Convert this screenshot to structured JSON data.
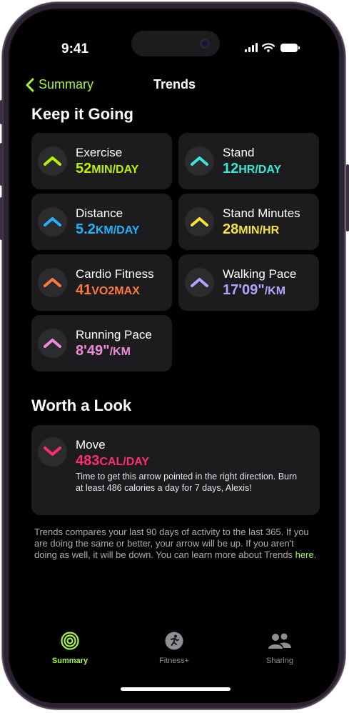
{
  "status_bar": {
    "time": "9:41"
  },
  "nav": {
    "back_label": "Summary",
    "title": "Trends"
  },
  "sections": {
    "keep_going": "Keep it Going",
    "worth_look": "Worth a Look"
  },
  "colors": {
    "accent_green": "#a3f740",
    "exercise": "#b9f200",
    "stand": "#3ce6d6",
    "distance": "#21b3ff",
    "stand_minutes": "#f5e23a",
    "cardio": "#ff7a3d",
    "walking": "#b6a1ff",
    "running": "#ef8ad9",
    "move": "#ff2d6f"
  },
  "trends": [
    {
      "label": "Exercise",
      "value": "52",
      "unit": "MIN/DAY",
      "direction": "up",
      "color_key": "exercise"
    },
    {
      "label": "Stand",
      "value": "12",
      "unit": "HR/DAY",
      "direction": "up",
      "color_key": "stand"
    },
    {
      "label": "Distance",
      "value": "5.2",
      "unit": "KM/DAY",
      "direction": "up",
      "color_key": "distance"
    },
    {
      "label": "Stand Minutes",
      "value": "28",
      "unit": "MIN/HR",
      "direction": "up",
      "color_key": "stand_minutes"
    },
    {
      "label": "Cardio Fitness",
      "value": "41",
      "unit": "VO2MAX",
      "direction": "up",
      "color_key": "cardio"
    },
    {
      "label": "Walking Pace",
      "value": "17'09\"",
      "unit": "/KM",
      "direction": "up",
      "color_key": "walking"
    },
    {
      "label": "Running Pace",
      "value": "8'49\"",
      "unit": "/KM",
      "direction": "up",
      "color_key": "running"
    }
  ],
  "worth_look": {
    "label": "Move",
    "value": "483",
    "unit": "CAL/DAY",
    "direction": "down",
    "description": "Time to get this arrow pointed in the right direction. Burn at least 486 calories a day for 7 days, Alexis!"
  },
  "footnote": {
    "text": "Trends compares your last 90 days of activity to the last 365. If you are doing the same or better, your arrow will be up. If you aren't doing as well, it will be down. You can learn more about Trends ",
    "link": "here",
    "end": "."
  },
  "tabs": [
    {
      "label": "Summary",
      "icon": "activity-rings-icon",
      "selected": true
    },
    {
      "label": "Fitness+",
      "icon": "runner-icon",
      "selected": false
    },
    {
      "label": "Sharing",
      "icon": "people-icon",
      "selected": false
    }
  ]
}
